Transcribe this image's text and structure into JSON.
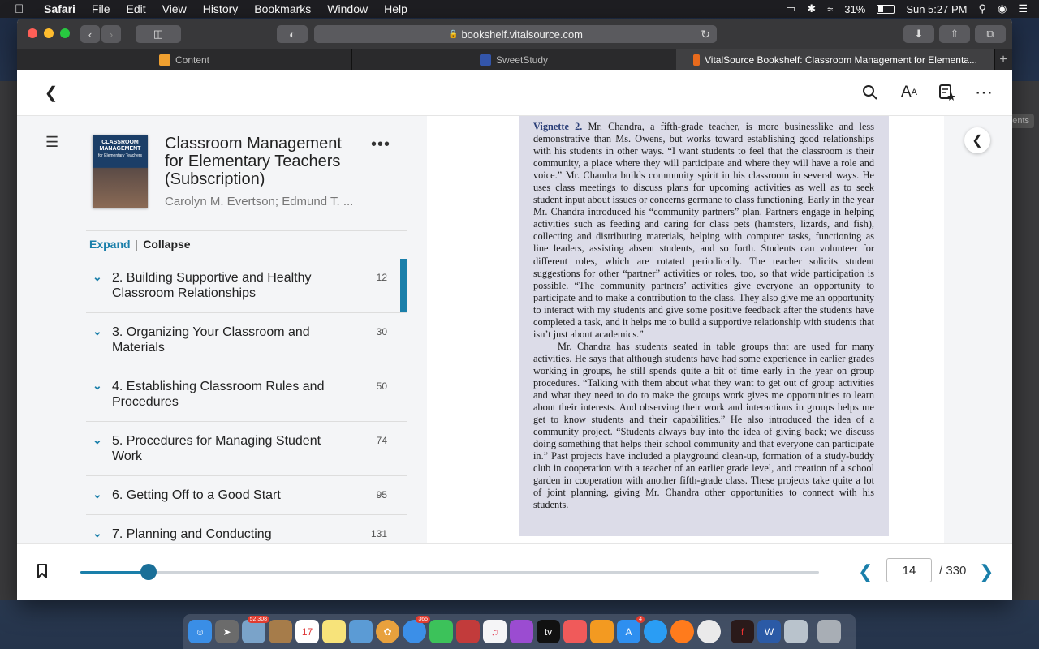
{
  "menubar": {
    "app": "Safari",
    "items": [
      "File",
      "Edit",
      "View",
      "History",
      "Bookmarks",
      "Window",
      "Help"
    ],
    "battery": "31%",
    "clock": "Sun 5:27 PM"
  },
  "browser": {
    "url": "bookshelf.vitalsource.com",
    "tabs": [
      {
        "label": "Content",
        "color": "#f0a030"
      },
      {
        "label": "SweetStudy",
        "color": "#3355aa"
      },
      {
        "label": "VitalSource Bookshelf: Classroom Management for Elementa...",
        "color": "#e86a1c"
      }
    ]
  },
  "book": {
    "title": "Classroom Management for Elementary Teachers (Subscription)",
    "author": "Carolyn M. Evertson; Edmund T. ...",
    "cover_text_top": "CLASSROOM MANAGEMENT",
    "cover_text_sub": "for Elementary Teachers"
  },
  "toc": {
    "expand_label": "Expand",
    "collapse_label": "Collapse",
    "items": [
      {
        "label": "2. Building Supportive and Healthy Classroom Relationships",
        "page": "12"
      },
      {
        "label": "3. Organizing Your Classroom and Materials",
        "page": "30"
      },
      {
        "label": "4. Establishing Classroom Rules and Procedures",
        "page": "50"
      },
      {
        "label": "5. Procedures for Managing Student Work",
        "page": "74"
      },
      {
        "label": "6. Getting Off to a Good Start",
        "page": "95"
      },
      {
        "label": "7. Planning and Conducting Instruction",
        "page": "131"
      }
    ]
  },
  "reader": {
    "vignette_label": "Vignette 2.",
    "para1": "Mr. Chandra, a fifth-grade teacher, is more businesslike and less demonstrative than Ms. Owens, but works toward establishing good relationships with his students in other ways. “I want students to feel that the classroom is their community, a place where they will participate and where they will have a role and voice.” Mr. Chandra builds community spirit in his classroom in several ways. He uses class meetings to discuss plans for upcoming activities as well as to seek student input about issues or concerns germane to class functioning. Early in the year Mr. Chandra introduced his “community partners” plan. Partners engage in helping activities such as feeding and caring for class pets (hamsters, lizards, and fish), collecting and distributing materials, helping with computer tasks, functioning as line leaders, assisting absent students, and so forth. Students can volunteer for different roles, which are rotated periodically. The teacher solicits student suggestions for other “partner” activities or roles, too, so that wide participation is possible. “The community partners’ activities give everyone an opportunity to participate and to make a contribution to the class. They also give me an opportunity to interact with my students and give some positive feedback after the students have completed a task, and it helps me to build a supportive relationship with students that isn’t just about academics.”",
    "para2": "Mr. Chandra has students seated in table groups that are used for many activities. He says that although students have had some experience in earlier grades working in groups, he still spends quite a bit of time early in the year on group procedures. “Talking with them about what they want to get out of group activities and what they need to do to make the groups work gives me opportunities to learn about their interests. And observing their work and interactions in groups helps me get to know students and their capabilities.” He also introduced the idea of a community project. “Students always buy into the idea of giving back; we discuss doing something that helps their school community and that everyone can participate in.” Past projects have included a playground clean-up, formation of a study-buddy club in cooperation with a teacher of an earlier grade level, and creation of a school garden in cooperation with another fifth-grade class. These projects take quite a lot of joint planning, giving Mr. Chandra other opportunities to connect with his students."
  },
  "navigation": {
    "current_page": "14",
    "total_pages": "/ 330",
    "progress": 0.092
  },
  "dock": {
    "badges": {
      "launchpad": "52,308",
      "messages": "365",
      "appstore": "4"
    }
  },
  "colors": {
    "accent": "#1a7faa"
  }
}
